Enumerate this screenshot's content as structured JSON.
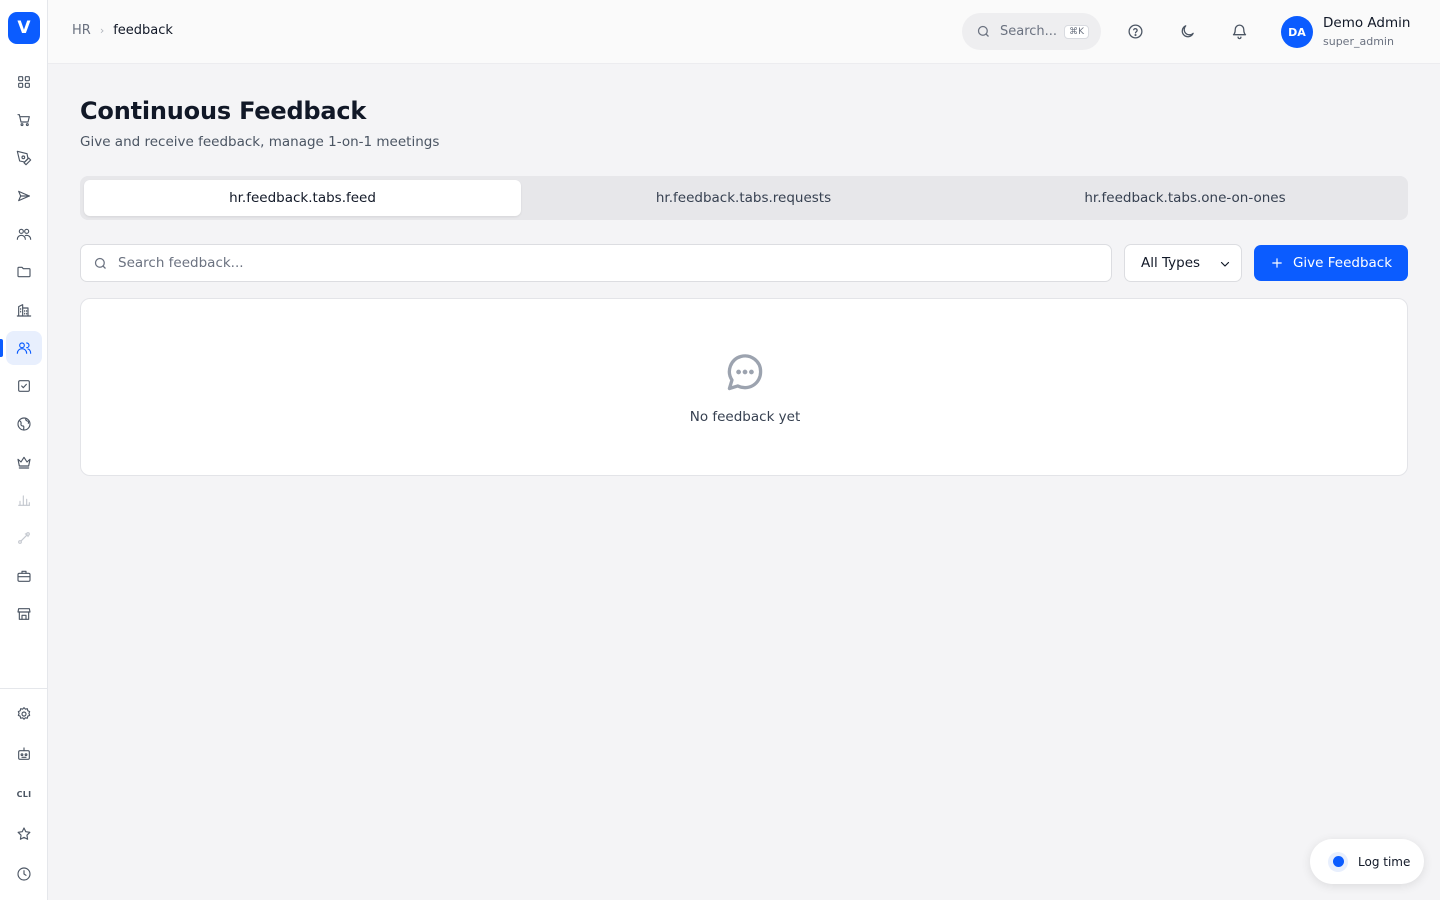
{
  "app": {
    "logo_letter": "V",
    "accent_color": "#0b5cff"
  },
  "breadcrumb": {
    "root": "HR",
    "current": "feedback"
  },
  "header": {
    "search_placeholder": "Search...",
    "search_shortcut": "⌘K",
    "user": {
      "initials": "DA",
      "name": "Demo Admin",
      "role": "super_admin"
    }
  },
  "sidebar": {
    "items": [
      {
        "icon": "dashboard-grid-icon"
      },
      {
        "icon": "shopping-cart-icon"
      },
      {
        "icon": "pen-tool-icon"
      },
      {
        "icon": "send-icon"
      },
      {
        "icon": "team-icon"
      },
      {
        "icon": "folder-icon"
      },
      {
        "icon": "building-icon"
      },
      {
        "icon": "users-icon",
        "active": true
      },
      {
        "icon": "checkbox-icon"
      },
      {
        "icon": "globe-icon"
      },
      {
        "icon": "crown-icon"
      },
      {
        "icon": "bar-chart-icon"
      },
      {
        "icon": "workflow-icon"
      },
      {
        "icon": "briefcase-icon"
      },
      {
        "icon": "store-icon"
      }
    ],
    "bottom": {
      "settings_icon": "gear-icon",
      "bot_icon": "robot-icon",
      "cli_label": "CLI",
      "favorites_icon": "star-icon",
      "history_icon": "clock-icon"
    }
  },
  "page": {
    "title": "Continuous Feedback",
    "subtitle": "Give and receive feedback, manage 1-on-1 meetings"
  },
  "tabs": [
    {
      "label": "hr.feedback.tabs.feed",
      "active": true
    },
    {
      "label": "hr.feedback.tabs.requests",
      "active": false
    },
    {
      "label": "hr.feedback.tabs.one-on-ones",
      "active": false
    }
  ],
  "filters": {
    "search_placeholder": "Search feedback...",
    "search_value": "",
    "type_selected": "All Types"
  },
  "actions": {
    "give_feedback_label": "Give Feedback"
  },
  "empty_state": {
    "icon": "message-circle-icon",
    "text": "No feedback yet"
  },
  "log_time": {
    "label": "Log time"
  }
}
